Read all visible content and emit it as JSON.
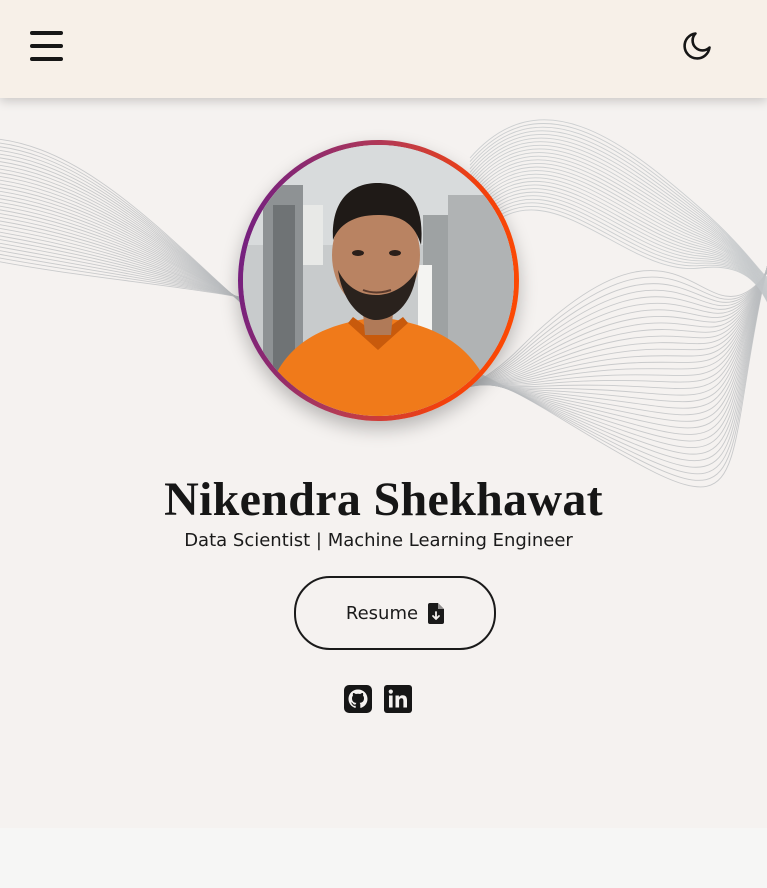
{
  "header": {
    "menu_icon": "hamburger-menu-icon",
    "theme_icon": "moon-icon"
  },
  "hero": {
    "name": "Nikendra Shekhawat",
    "role": "Data Scientist | Machine Learning Engineer",
    "resume_label": "Resume",
    "resume_icon": "file-download-icon",
    "socials": [
      {
        "name": "github",
        "icon": "github-icon"
      },
      {
        "name": "linkedin",
        "icon": "linkedin-icon"
      }
    ],
    "photo_icon": "profile-photo"
  },
  "colors": {
    "navbar_bg": "#f7f0e8",
    "page_bg": "#f5f2f0",
    "ring_start": "#6a1b86",
    "ring_end": "#ff4d00",
    "shirt": "#f07a1a",
    "text": "#1a1a1a"
  }
}
